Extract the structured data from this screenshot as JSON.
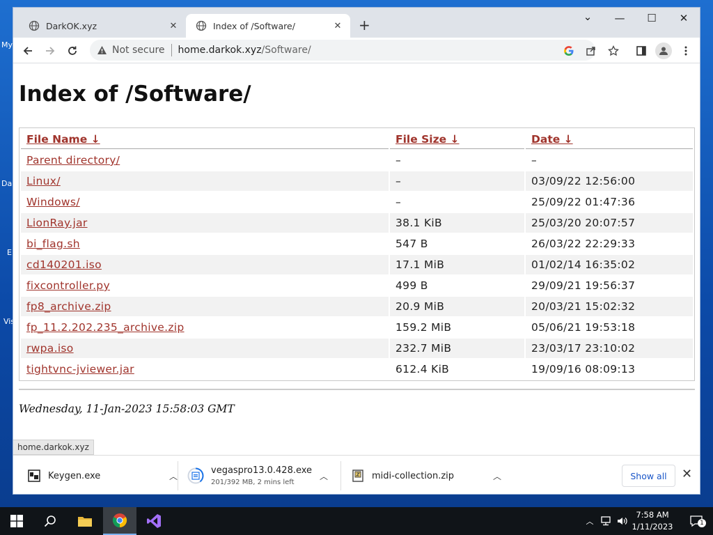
{
  "desktop": {
    "fragments": [
      "My",
      "Da",
      "E",
      "Vis"
    ]
  },
  "browser": {
    "tabs": [
      {
        "title": "DarkOK.xyz",
        "active": false
      },
      {
        "title": "Index of /Software/",
        "active": true
      }
    ],
    "new_tab": "+",
    "window_controls": {
      "dropdown": "⌄",
      "minimize": "—",
      "maximize": "☐",
      "close": "✕"
    },
    "address": {
      "security_label": "Not secure",
      "host": "home.darkok.xyz",
      "path": "/Software/"
    },
    "status_url": "home.darkok.xyz"
  },
  "page": {
    "title": "Index of /Software/",
    "columns": [
      "File Name  ↓",
      "File Size  ↓",
      "Date  ↓"
    ],
    "rows": [
      {
        "name": "Parent directory/",
        "size": "–",
        "date": "–"
      },
      {
        "name": "Linux/",
        "size": "–",
        "date": "03/09/22 12:56:00"
      },
      {
        "name": "Windows/",
        "size": "–",
        "date": "25/09/22 01:47:36"
      },
      {
        "name": "LionRay.jar",
        "size": "38.1 KiB",
        "date": "25/03/20 20:07:57"
      },
      {
        "name": "bi_flag.sh",
        "size": "547 B",
        "date": "26/03/22 22:29:33"
      },
      {
        "name": "cd140201.iso",
        "size": "17.1 MiB",
        "date": "01/02/14 16:35:02"
      },
      {
        "name": "fixcontroller.py",
        "size": "499 B",
        "date": "29/09/21 19:56:37"
      },
      {
        "name": "fp8_archive.zip",
        "size": "20.9 MiB",
        "date": "20/03/21 15:02:32"
      },
      {
        "name": "fp_11.2.202.235_archive.zip",
        "size": "159.2 MiB",
        "date": "05/06/21 19:53:18"
      },
      {
        "name": "rwpa.iso",
        "size": "232.7 MiB",
        "date": "23/03/17 23:10:02"
      },
      {
        "name": "tightvnc-jviewer.jar",
        "size": "612.4 KiB",
        "date": "19/09/16 08:09:13"
      }
    ],
    "generated": "Wednesday, 11-Jan-2023 15:58:03 GMT"
  },
  "downloads": {
    "items": [
      {
        "name": "Keygen.exe",
        "detail": ""
      },
      {
        "name": "vegaspro13.0.428.exe",
        "detail": "201/392 MB, 2 mins left"
      },
      {
        "name": "midi-collection.zip",
        "detail": ""
      }
    ],
    "show_all": "Show all"
  },
  "taskbar": {
    "time": "7:58 AM",
    "date": "1/11/2023",
    "notification_count": "1"
  },
  "colors": {
    "link": "#a0342c",
    "accent_blue": "#1a56c8",
    "desktop_blue": "#1e6fd0"
  }
}
